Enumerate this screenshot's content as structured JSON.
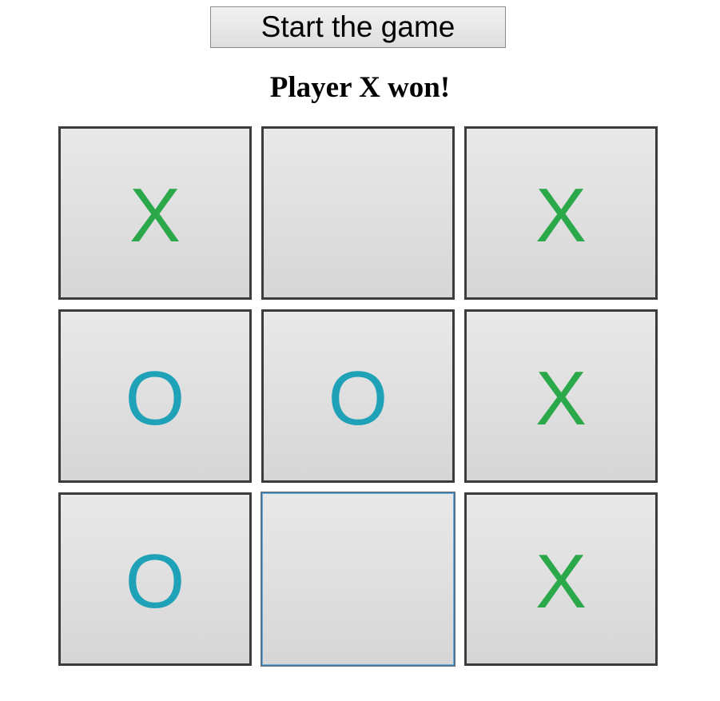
{
  "start_button_label": "Start the game",
  "status_text": "Player X won!",
  "colors": {
    "x": "#2aa84a",
    "o": "#1fa2b8"
  },
  "board": [
    [
      "X",
      "",
      "X"
    ],
    [
      "O",
      "O",
      "X"
    ],
    [
      "O",
      "",
      "X"
    ]
  ]
}
